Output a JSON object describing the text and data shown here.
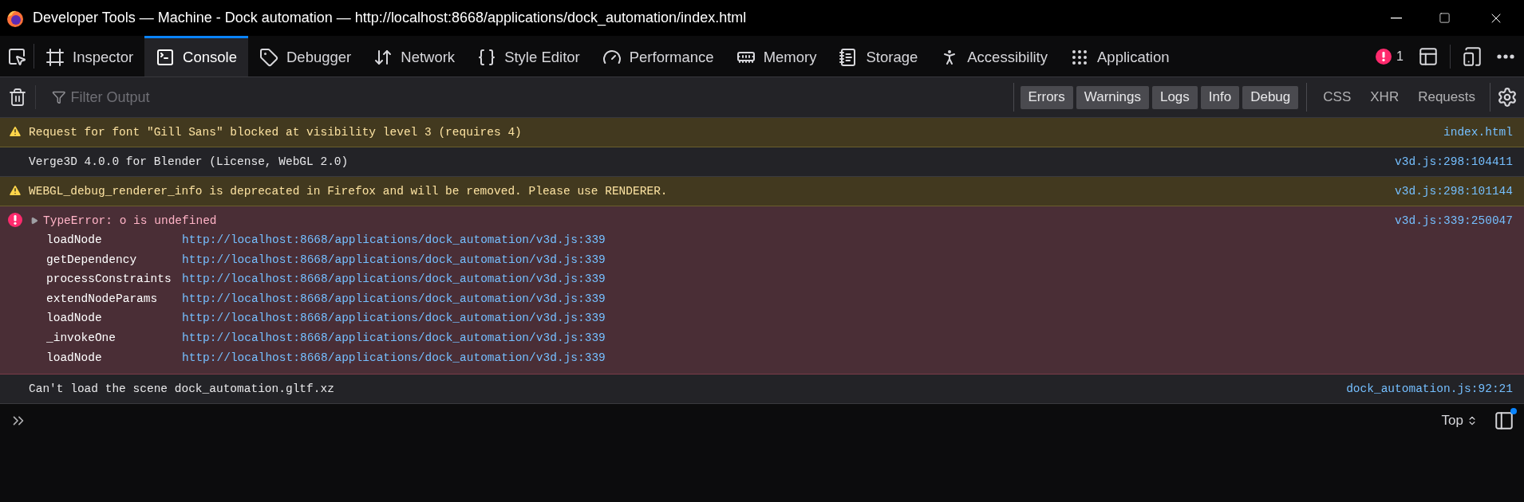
{
  "window": {
    "title": "Developer Tools — Machine - Dock automation — http://localhost:8668/applications/dock_automation/index.html"
  },
  "tabs": [
    {
      "label": "Inspector",
      "selected": false
    },
    {
      "label": "Console",
      "selected": true
    },
    {
      "label": "Debugger",
      "selected": false
    },
    {
      "label": "Network",
      "selected": false
    },
    {
      "label": "Style Editor",
      "selected": false
    },
    {
      "label": "Performance",
      "selected": false
    },
    {
      "label": "Memory",
      "selected": false
    },
    {
      "label": "Storage",
      "selected": false
    },
    {
      "label": "Accessibility",
      "selected": false
    },
    {
      "label": "Application",
      "selected": false
    }
  ],
  "error_count": "1",
  "filter": {
    "placeholder": "Filter Output"
  },
  "levels": [
    {
      "label": "Errors",
      "selected": true
    },
    {
      "label": "Warnings",
      "selected": true
    },
    {
      "label": "Logs",
      "selected": true
    },
    {
      "label": "Info",
      "selected": true
    },
    {
      "label": "Debug",
      "selected": true
    }
  ],
  "types": [
    {
      "label": "CSS",
      "selected": false
    },
    {
      "label": "XHR",
      "selected": false
    },
    {
      "label": "Requests",
      "selected": false
    }
  ],
  "messages": [
    {
      "kind": "warning",
      "text": "Request for font \"Gill Sans\" blocked at visibility level 3 (requires 4)",
      "source": "index.html"
    },
    {
      "kind": "log",
      "text": "Verge3D 4.0.0 for Blender (License, WebGL 2.0)",
      "source": "v3d.js:298:104411"
    },
    {
      "kind": "warning",
      "text": "WEBGL_debug_renderer_info is deprecated in Firefox and will be removed. Please use RENDERER.",
      "source": "v3d.js:298:101144"
    },
    {
      "kind": "error",
      "text": "TypeError: o is undefined",
      "source": "v3d.js:339:250047",
      "expanded": false,
      "frames": [
        {
          "function": "loadNode",
          "url": "http://localhost:8668/applications/dock_automation/v3d.js:339"
        },
        {
          "function": "getDependency",
          "url": "http://localhost:8668/applications/dock_automation/v3d.js:339"
        },
        {
          "function": "processConstraints",
          "url": "http://localhost:8668/applications/dock_automation/v3d.js:339"
        },
        {
          "function": "extendNodeParams",
          "url": "http://localhost:8668/applications/dock_automation/v3d.js:339"
        },
        {
          "function": "loadNode",
          "url": "http://localhost:8668/applications/dock_automation/v3d.js:339"
        },
        {
          "function": "_invokeOne",
          "url": "http://localhost:8668/applications/dock_automation/v3d.js:339"
        },
        {
          "function": "loadNode",
          "url": "http://localhost:8668/applications/dock_automation/v3d.js:339"
        }
      ]
    },
    {
      "kind": "log",
      "text": "Can't load the scene dock_automation.gltf.xz",
      "source": "dock_automation.js:92:21"
    }
  ],
  "context": {
    "label": "Top"
  }
}
